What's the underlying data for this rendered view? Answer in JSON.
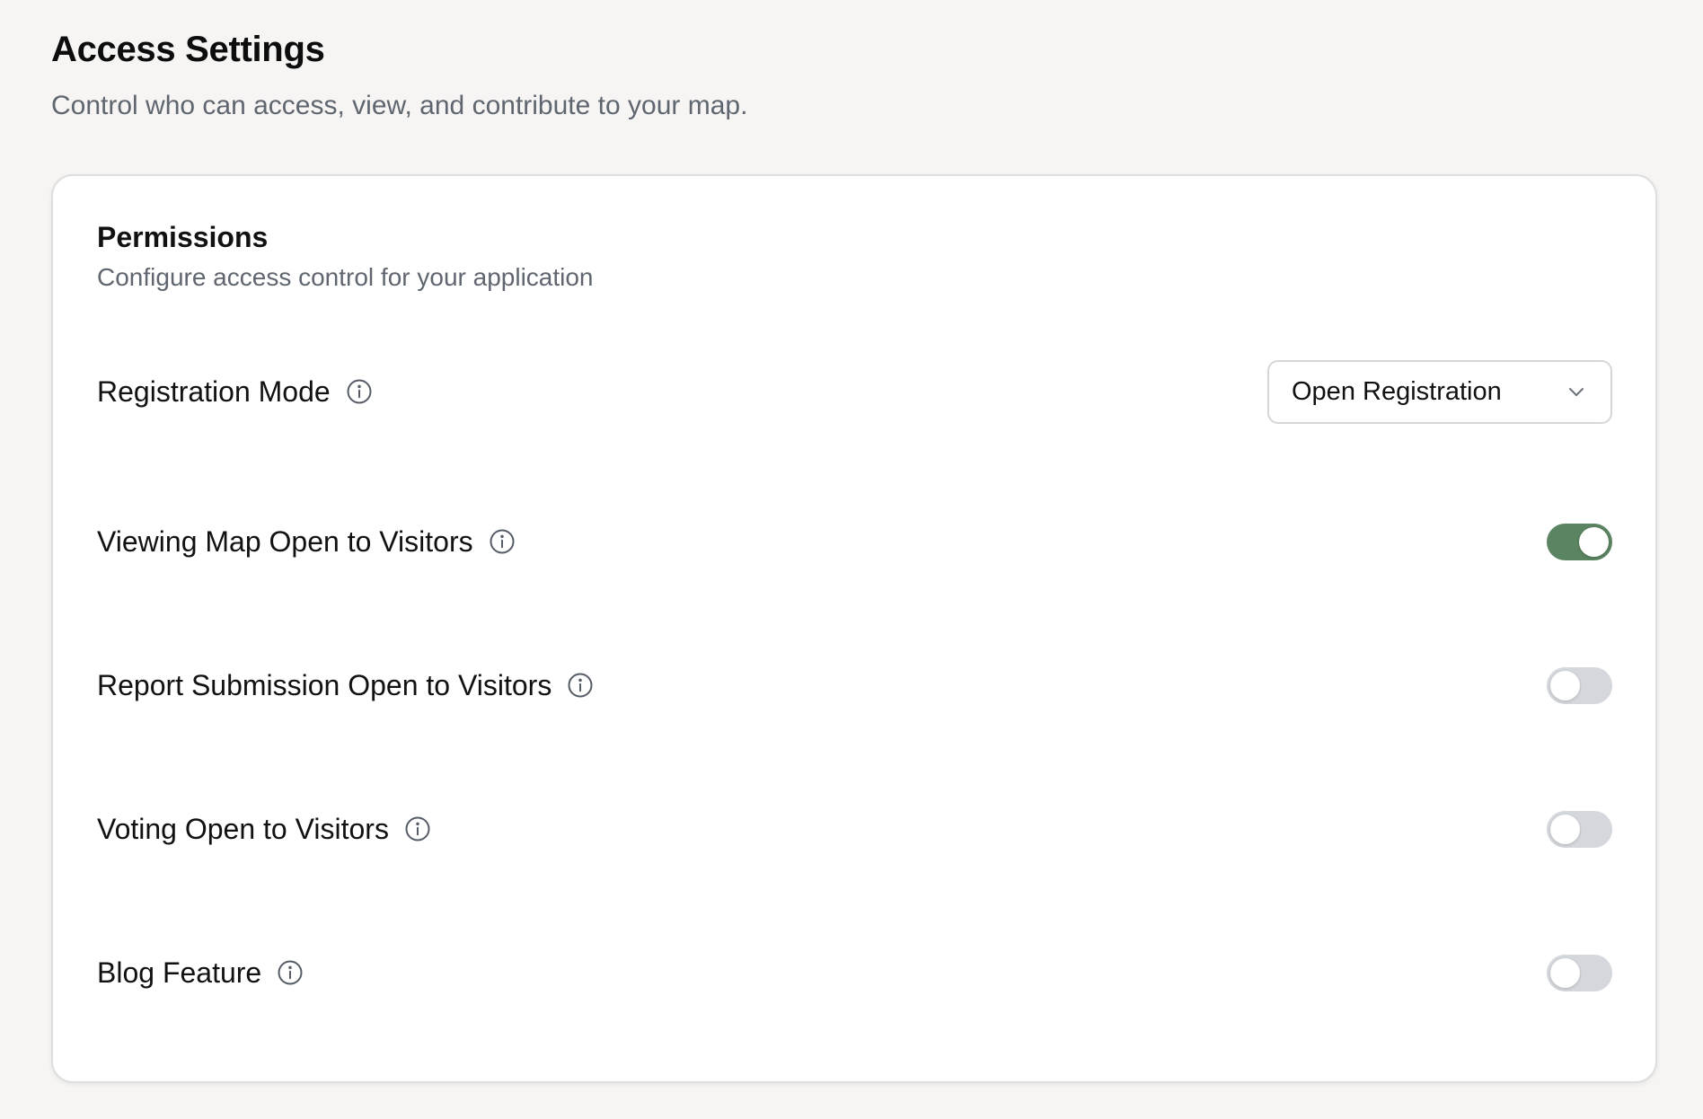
{
  "page": {
    "title": "Access Settings",
    "subtitle": "Control who can access, view, and contribute to your map."
  },
  "card": {
    "title": "Permissions",
    "subtitle": "Configure access control for your application"
  },
  "settings": [
    {
      "label": "Registration Mode",
      "control": "select",
      "value": "Open Registration",
      "icons": [
        "info-icon",
        "chevron-down-icon"
      ]
    },
    {
      "label": "Viewing Map Open to Visitors",
      "control": "toggle",
      "enabled": true,
      "icon": "info-icon"
    },
    {
      "label": "Report Submission Open to Visitors",
      "control": "toggle",
      "enabled": false,
      "icon": "info-icon"
    },
    {
      "label": "Voting Open to Visitors",
      "control": "toggle",
      "enabled": false,
      "icon": "info-icon"
    },
    {
      "label": "Blog Feature",
      "control": "toggle",
      "enabled": false,
      "icon": "info-icon"
    }
  ],
  "colors": {
    "toggle_on": "#5b8462",
    "toggle_off": "#d4d7db",
    "page_background": "#f6f5f3",
    "muted_text": "#5f6670"
  }
}
